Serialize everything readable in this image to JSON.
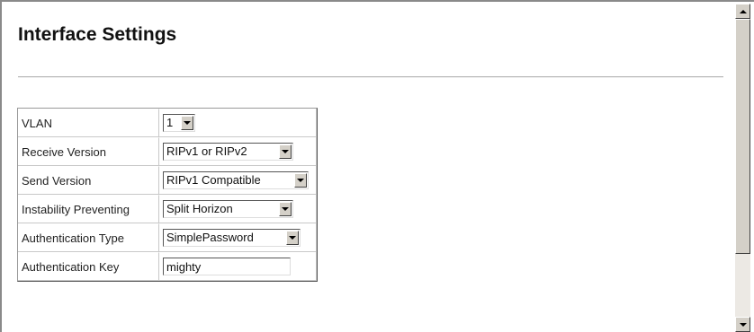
{
  "page": {
    "title": "Interface Settings"
  },
  "form": {
    "vlan": {
      "label": "VLAN",
      "value": "1"
    },
    "receive_version": {
      "label": "Receive Version",
      "value": "RIPv1 or RIPv2"
    },
    "send_version": {
      "label": "Send Version",
      "value": "RIPv1 Compatible"
    },
    "instability_preventing": {
      "label": "Instability Preventing",
      "value": "Split Horizon"
    },
    "authentication_type": {
      "label": "Authentication Type",
      "value": "SimplePassword"
    },
    "authentication_key": {
      "label": "Authentication Key",
      "value": "mighty"
    }
  },
  "scrollbar": {
    "position": 0
  }
}
